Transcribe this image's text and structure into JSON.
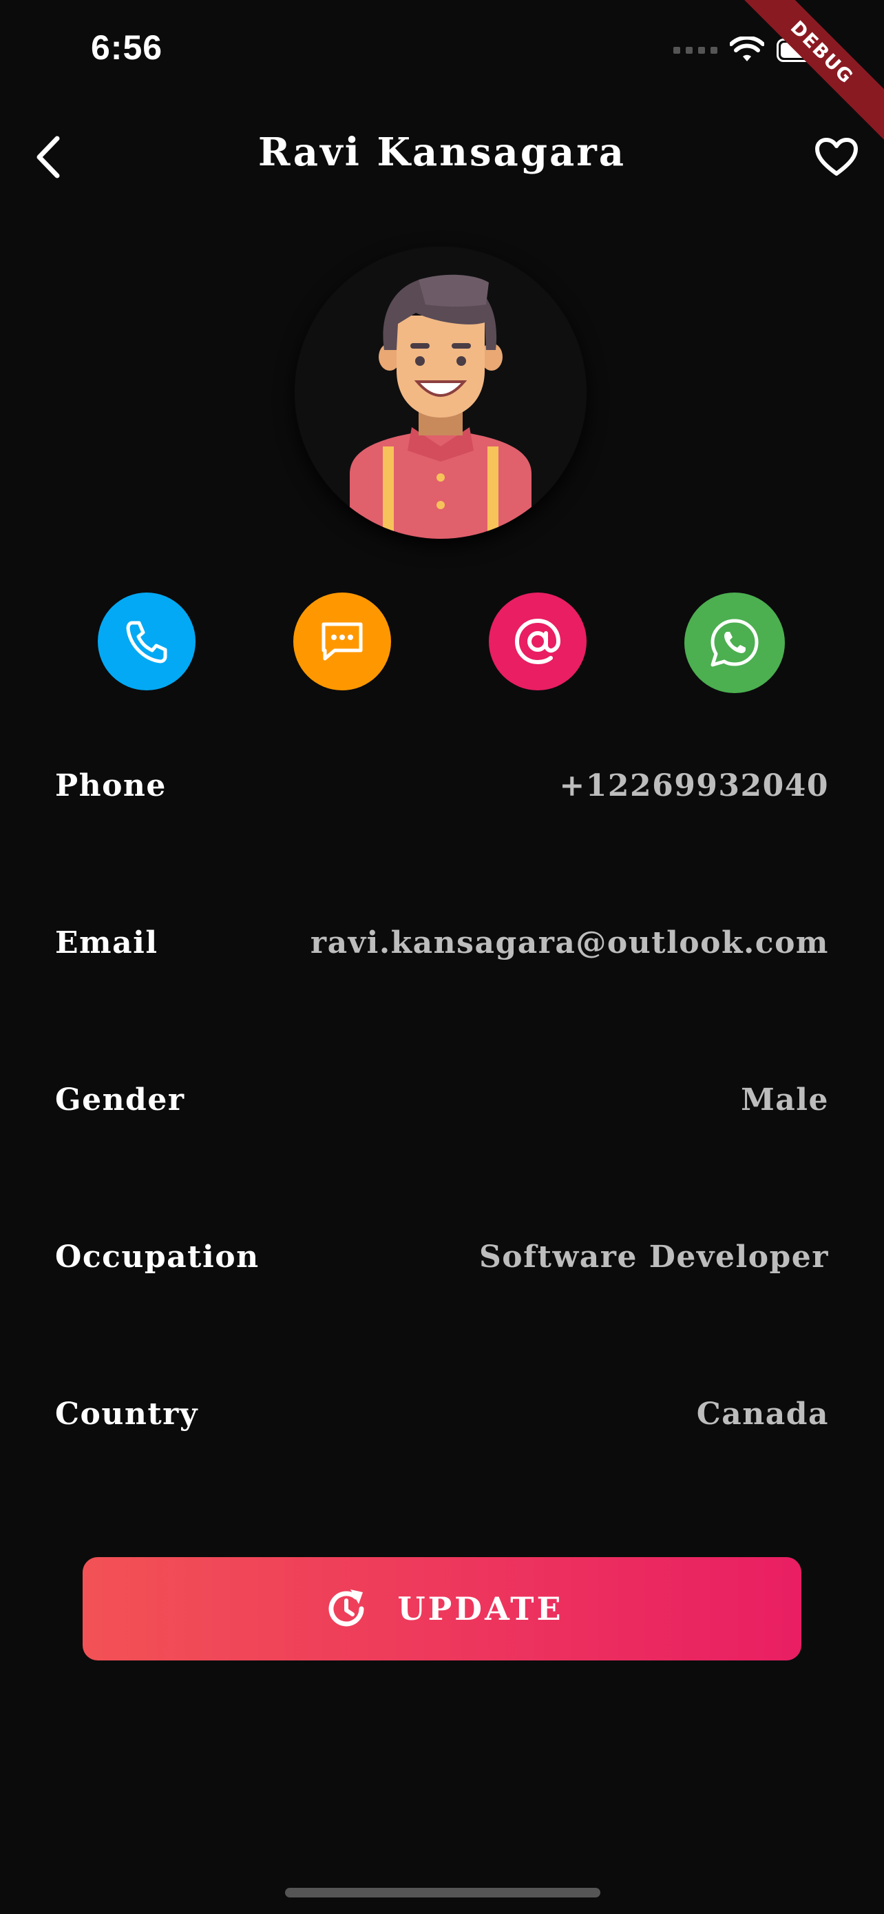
{
  "status_bar": {
    "time": "6:56",
    "debug_label": "DEBUG"
  },
  "header": {
    "title": "Ravi Kansagara",
    "back_icon": "chevron-left-icon",
    "favorite_icon": "heart-outline-icon"
  },
  "profile": {
    "avatar": "avatar-illustration"
  },
  "actions": [
    {
      "name": "call",
      "icon": "phone-icon",
      "color": "#03A9F4"
    },
    {
      "name": "message",
      "icon": "message-icon",
      "color": "#FF9800"
    },
    {
      "name": "email",
      "icon": "at-sign-icon",
      "color": "#E91E63"
    },
    {
      "name": "whatsapp",
      "icon": "whatsapp-icon",
      "color": "#4CAF50"
    }
  ],
  "info": [
    {
      "label": "Phone",
      "value": "+12269932040"
    },
    {
      "label": "Email",
      "value": "ravi.kansagara@outlook.com"
    },
    {
      "label": "Gender",
      "value": "Male"
    },
    {
      "label": "Occupation",
      "value": "Software Developer"
    },
    {
      "label": "Country",
      "value": "Canada"
    }
  ],
  "update_button": {
    "label": "UPDATE",
    "icon": "update-icon",
    "gradient": [
      "#F25255",
      "#E91E63"
    ]
  },
  "colors": {
    "background": "#0B0B0C",
    "value_text": "#BDBDBD"
  }
}
